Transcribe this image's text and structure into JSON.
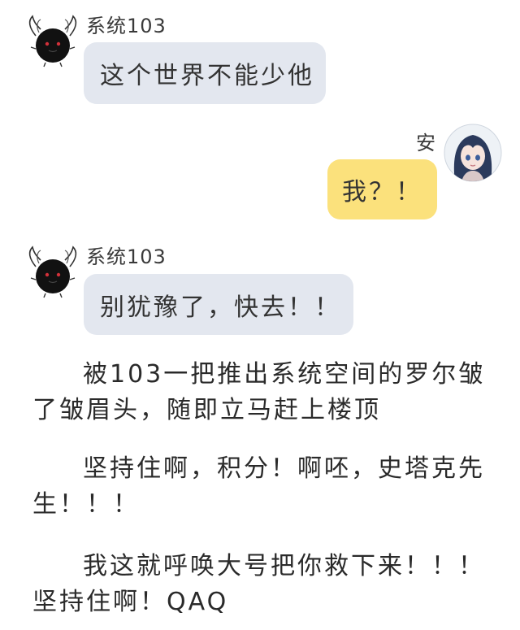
{
  "messages": [
    {
      "sender": "系统103",
      "side": "left",
      "text": "这个世界不能少他",
      "avatar_icon": "black-orb-mascot-icon"
    },
    {
      "sender": "安",
      "side": "right",
      "text": "我？！",
      "avatar_icon": "anime-girl-avatar-icon"
    },
    {
      "sender": "系统103",
      "side": "left",
      "text": "别犹豫了，快去！！",
      "avatar_icon": "black-orb-mascot-icon"
    }
  ],
  "narration": [
    "被103一把推出系统空间的罗尔皱了皱眉头，随即立马赶上楼顶",
    "坚持住啊，积分！啊呸，史塔克先生！！！",
    "我这就呼唤大号把你救下来！！！坚持住啊！QAQ"
  ],
  "colors": {
    "left_bubble": "#e3e7ef",
    "right_bubble": "#fbe17c",
    "text": "#2a2a2a"
  }
}
